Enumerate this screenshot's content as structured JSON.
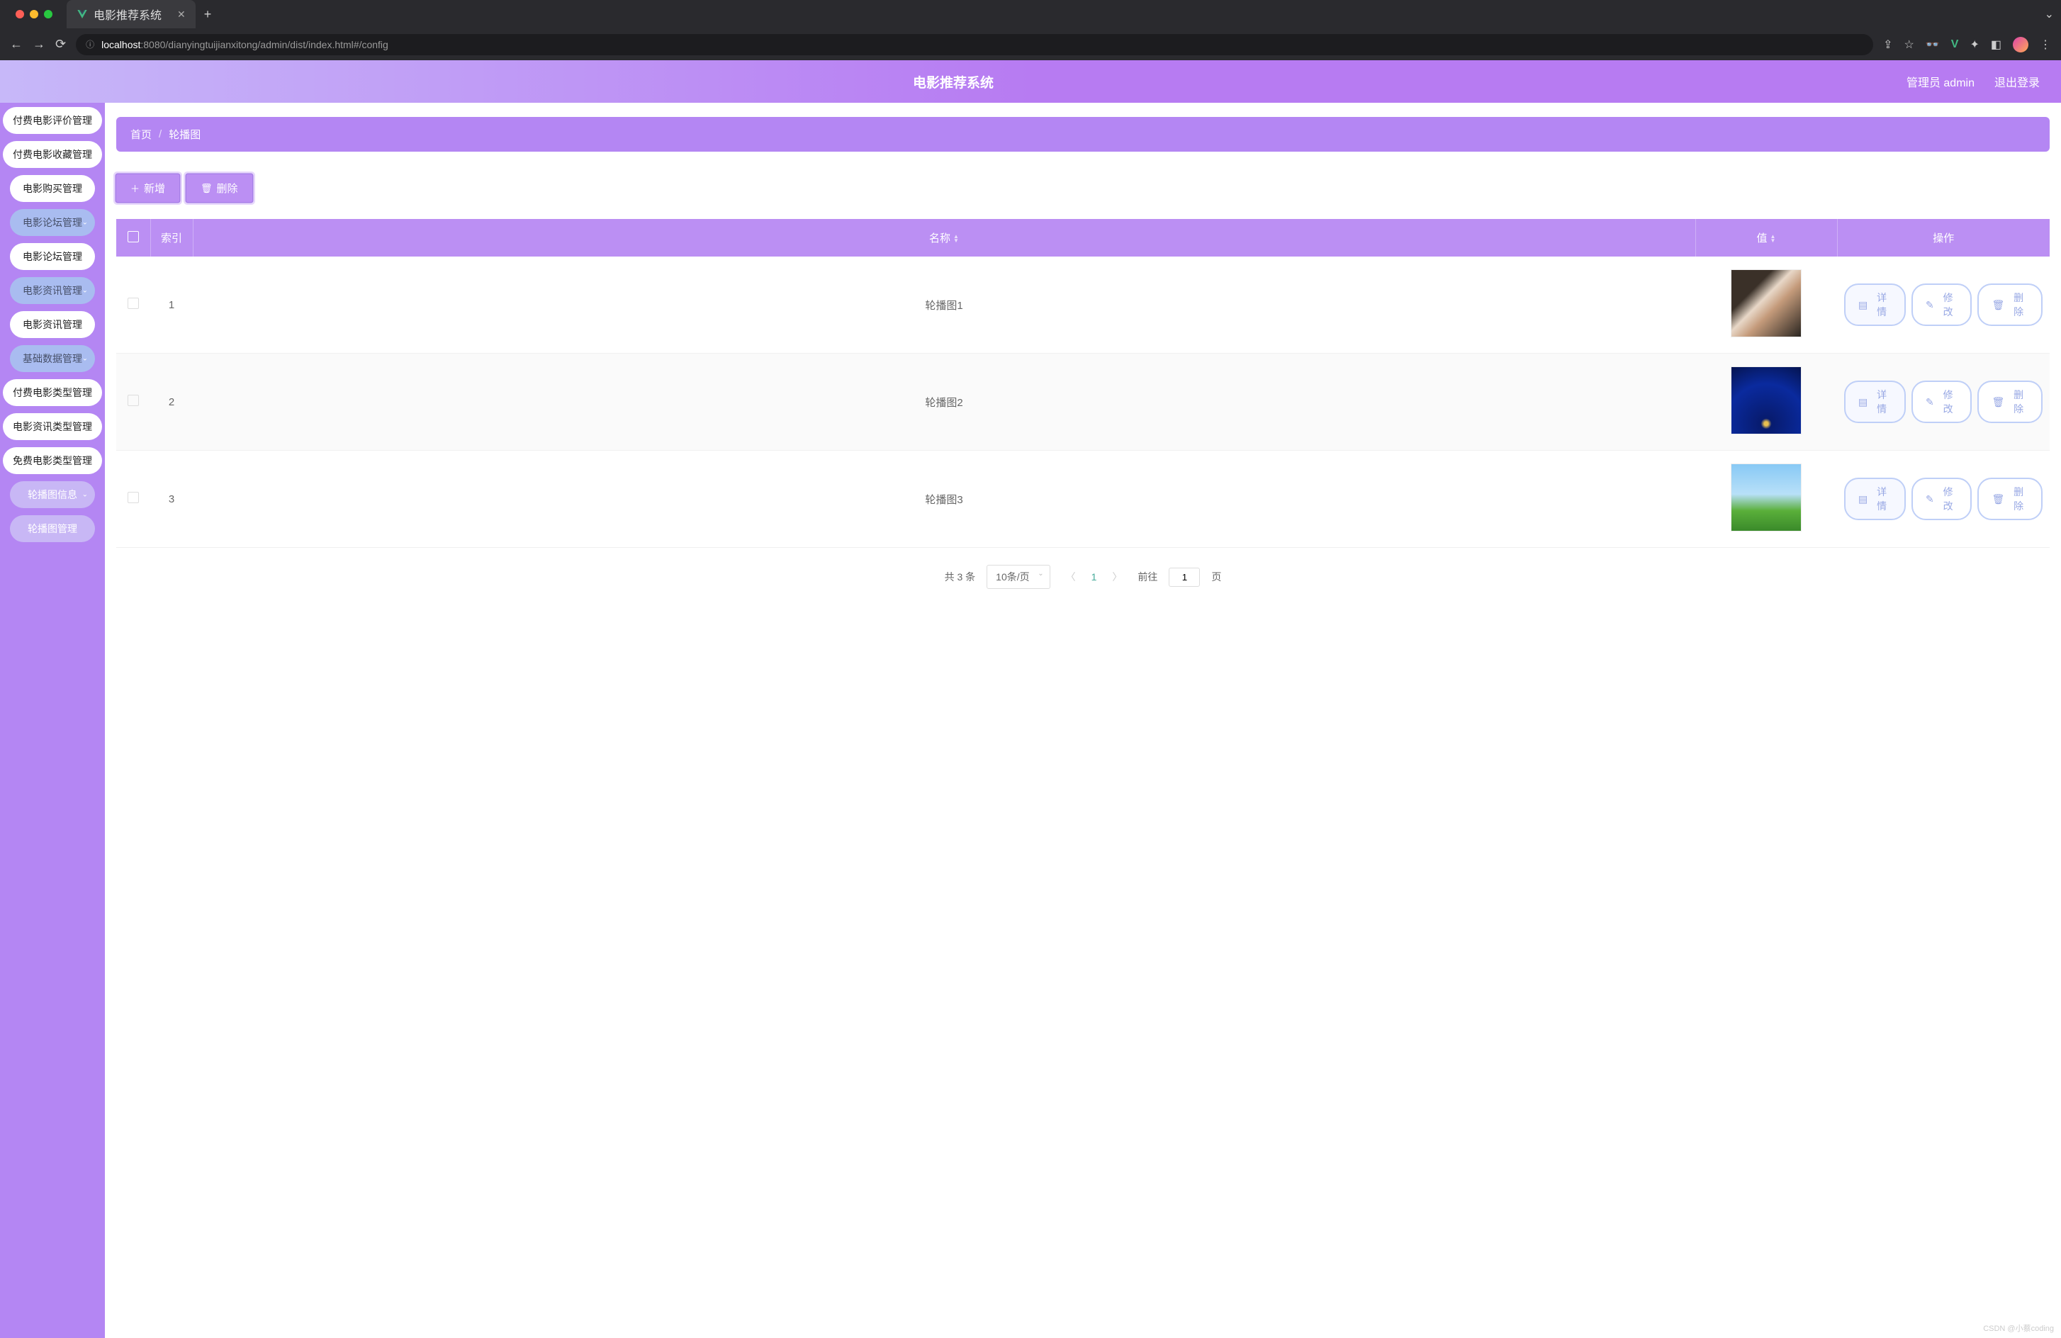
{
  "browser": {
    "tab_title": "电影推荐系统",
    "url_host": "localhost",
    "url_port": ":8080",
    "url_path": "/dianyingtuijianxitong/admin/dist/index.html#/config"
  },
  "header": {
    "title": "电影推荐系统",
    "user": "管理员 admin",
    "logout": "退出登录"
  },
  "sidebar": {
    "items": [
      {
        "label": "付费电影评价管理",
        "type": "item"
      },
      {
        "label": "付费电影收藏管理",
        "type": "item"
      },
      {
        "label": "电影购买管理",
        "type": "item"
      },
      {
        "label": "电影论坛管理",
        "type": "group"
      },
      {
        "label": "电影论坛管理",
        "type": "item"
      },
      {
        "label": "电影资讯管理",
        "type": "group"
      },
      {
        "label": "电影资讯管理",
        "type": "item"
      },
      {
        "label": "基础数据管理",
        "type": "group"
      },
      {
        "label": "付费电影类型管理",
        "type": "item"
      },
      {
        "label": "电影资讯类型管理",
        "type": "item"
      },
      {
        "label": "免费电影类型管理",
        "type": "item"
      },
      {
        "label": "轮播图信息",
        "type": "group-light"
      },
      {
        "label": "轮播图管理",
        "type": "group-light-plain"
      }
    ]
  },
  "breadcrumb": {
    "home": "首页",
    "current": "轮播图"
  },
  "actions": {
    "add": "新增",
    "delete": "删除"
  },
  "table": {
    "headers": {
      "index": "索引",
      "name": "名称",
      "value": "值",
      "ops": "操作"
    },
    "rows": [
      {
        "index": "1",
        "name": "轮播图1"
      },
      {
        "index": "2",
        "name": "轮播图2"
      },
      {
        "index": "3",
        "name": "轮播图3"
      }
    ],
    "row_actions": {
      "detail": "详情",
      "edit": "修改",
      "delete": "删除"
    }
  },
  "pagination": {
    "total_label": "共 3 条",
    "page_size": "10条/页",
    "current": "1",
    "goto_prefix": "前往",
    "goto_value": "1",
    "goto_suffix": "页"
  },
  "watermark": "CSDN @小蔡coding"
}
